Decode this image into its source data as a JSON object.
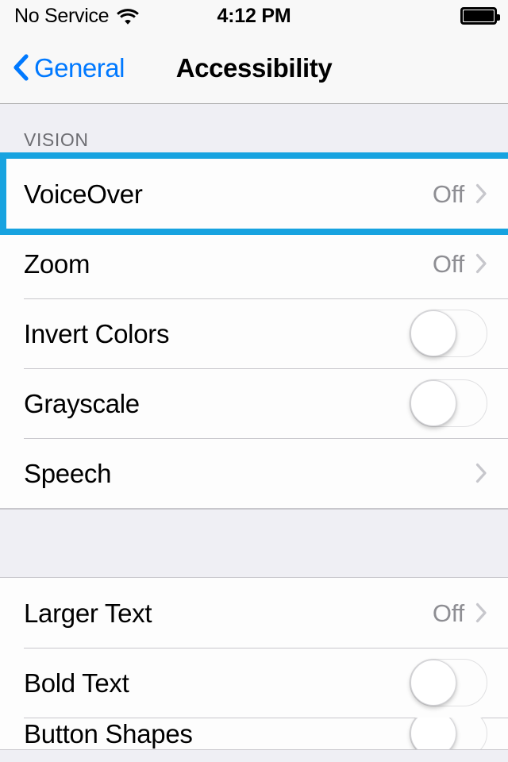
{
  "status_bar": {
    "carrier": "No Service",
    "wifi_icon": "wifi-icon",
    "time": "4:12 PM",
    "battery_icon": "battery-full-icon",
    "battery_level_percent": 100
  },
  "nav_bar": {
    "back_icon": "chevron-left-icon",
    "back_label": "General",
    "title": "Accessibility"
  },
  "sections": [
    {
      "header": "VISION",
      "rows": [
        {
          "label": "VoiceOver",
          "value": "Off",
          "accessory": "chevron-right-icon",
          "highlighted": true
        },
        {
          "label": "Zoom",
          "value": "Off",
          "accessory": "chevron-right-icon",
          "highlighted": false
        },
        {
          "label": "Invert Colors",
          "value": "",
          "accessory": "toggle-off",
          "highlighted": false
        },
        {
          "label": "Grayscale",
          "value": "",
          "accessory": "toggle-off",
          "highlighted": false
        },
        {
          "label": "Speech",
          "value": "",
          "accessory": "chevron-right-icon",
          "highlighted": false
        }
      ]
    },
    {
      "header": "",
      "rows": [
        {
          "label": "Larger Text",
          "value": "Off",
          "accessory": "chevron-right-icon",
          "highlighted": false
        },
        {
          "label": "Bold Text",
          "value": "",
          "accessory": "toggle-off",
          "highlighted": false
        },
        {
          "label": "Button Shapes",
          "value": "",
          "accessory": "toggle-off",
          "highlighted": false
        }
      ]
    }
  ],
  "colors": {
    "tint_blue": "#0079FF",
    "highlight_blue": "#17A3E0",
    "group_background": "#EFEFF4",
    "row_background": "#FDFDFD",
    "separator": "#C8C7CC",
    "value_gray": "#8E8E93",
    "header_gray": "#6D6D72",
    "chevron_gray": "#C7C7CC"
  }
}
